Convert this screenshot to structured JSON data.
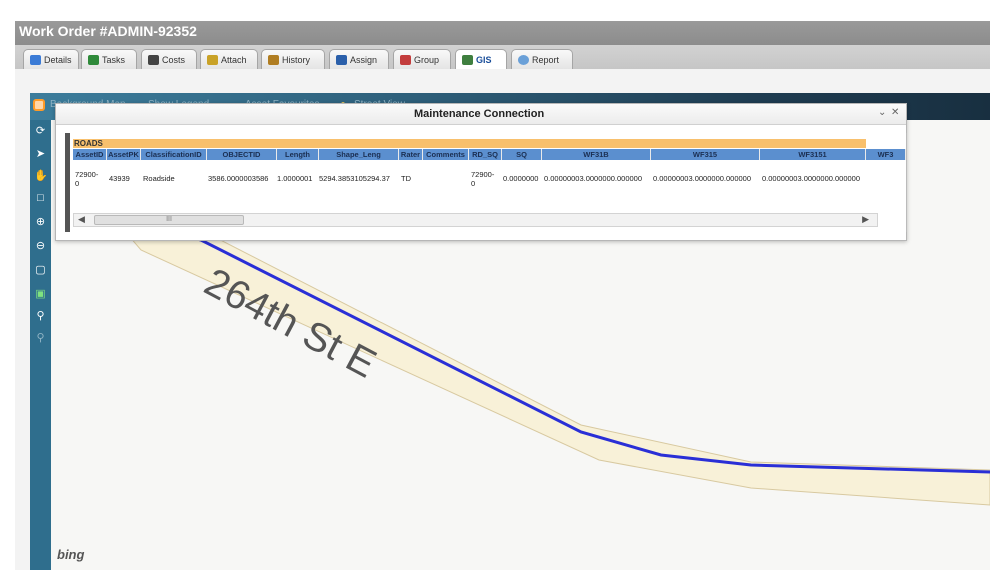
{
  "window": {
    "title": "Work Order #ADMIN-92352"
  },
  "tabs": [
    {
      "label": "Details",
      "icon": "details-icon",
      "color": "#3b7bd6"
    },
    {
      "label": "Tasks",
      "icon": "tasks-icon",
      "color": "#2f8a3a"
    },
    {
      "label": "Costs",
      "icon": "costs-icon",
      "color": "#444444"
    },
    {
      "label": "Attach",
      "icon": "attach-icon",
      "color": "#c9a227"
    },
    {
      "label": "History",
      "icon": "history-icon",
      "color": "#b07d21"
    },
    {
      "label": "Assign",
      "icon": "assign-icon",
      "color": "#2a5faa"
    },
    {
      "label": "Group",
      "icon": "group-icon",
      "color": "#c33c3c"
    },
    {
      "label": "GIS",
      "icon": "gis-icon",
      "color": "#3f7f3f",
      "active": true
    },
    {
      "label": "Report",
      "icon": "report-icon",
      "color": "#6aa0d8"
    }
  ],
  "map_toolbar": {
    "items": [
      "Background Map",
      "Show Legend",
      "Asset Favourites",
      "Street View"
    ]
  },
  "dialog": {
    "title": "Maintenance Connection",
    "layer_name": "ROADS",
    "columns": [
      "AssetID",
      "AssetPK",
      "ClassificationID",
      "OBJECTID",
      "Length",
      "Shape_Leng",
      "Rater",
      "Comments",
      "RD_SQ",
      "SQ",
      "WF31B",
      "WF315",
      "WF3151",
      "WF3"
    ],
    "row": [
      "72900-0",
      "43939",
      "Roadside",
      "3586.0000003586",
      "1.0000001",
      "5294.3853105294.37",
      "TD",
      "",
      "72900-0",
      "0.0000000",
      "0.00000003.0000000.000000",
      "0.00000003.0000000.000000",
      "0.00000003.0000000.000000",
      ""
    ],
    "scroll_label": "III"
  },
  "map": {
    "street_name": "264th St E",
    "attribution": "bing",
    "road_color": "#2a2fd6",
    "buffer_color": "#f8f1d8"
  }
}
